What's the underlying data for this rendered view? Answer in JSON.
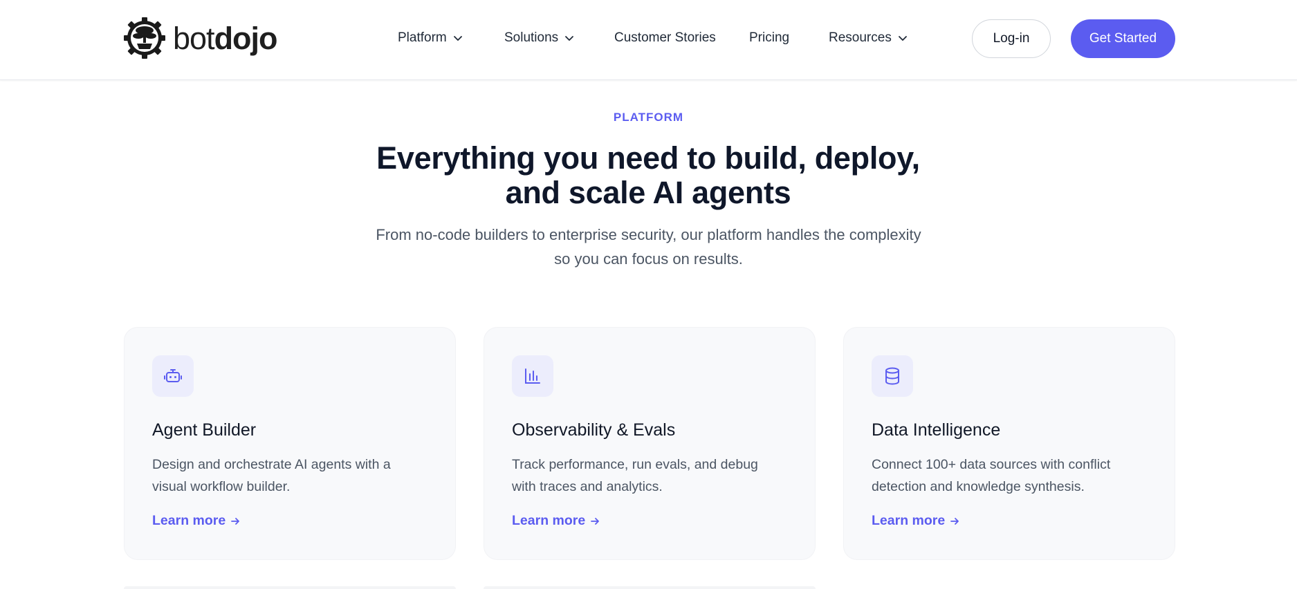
{
  "brand": {
    "light": "bot",
    "bold": "dojo",
    "logo_icon": "bonsai-gear-icon"
  },
  "nav": {
    "items": [
      {
        "label": "Platform",
        "has_dropdown": true
      },
      {
        "label": "Solutions",
        "has_dropdown": true
      },
      {
        "label": "Customer Stories",
        "has_dropdown": false
      },
      {
        "label": "Pricing",
        "has_dropdown": false
      },
      {
        "label": "Resources",
        "has_dropdown": true
      }
    ],
    "login_label": "Log-in",
    "cta_label": "Get Started"
  },
  "hero": {
    "eyebrow": "PLATFORM",
    "headline_line1": "Everything you need to build, deploy,",
    "headline_line2": "and scale AI agents",
    "subhead_line1": "From no-code builders to enterprise security, our platform handles the complexity",
    "subhead_line2": "so you can focus on results."
  },
  "cards": [
    {
      "icon": "robot-icon",
      "title": "Agent Builder",
      "desc_line1": "Design and orchestrate AI agents with a",
      "desc_line2": "visual workflow builder.",
      "link": "Learn more"
    },
    {
      "icon": "bar-chart-icon",
      "title": "Observability & Evals",
      "desc_line1": "Track performance, run evals, and debug",
      "desc_line2": "with traces and analytics.",
      "link": "Learn more"
    },
    {
      "icon": "database-icon",
      "title": "Data Intelligence",
      "desc_line1": "Connect 100+ data sources with conflict",
      "desc_line2": "detection and knowledge synthesis.",
      "link": "Learn more"
    }
  ],
  "colors": {
    "accent": "#5b5cf0",
    "text_dark": "#0f172a",
    "text_muted": "#4b5563",
    "card_bg": "#f8f9fb",
    "icon_bg": "#ecedfc"
  }
}
